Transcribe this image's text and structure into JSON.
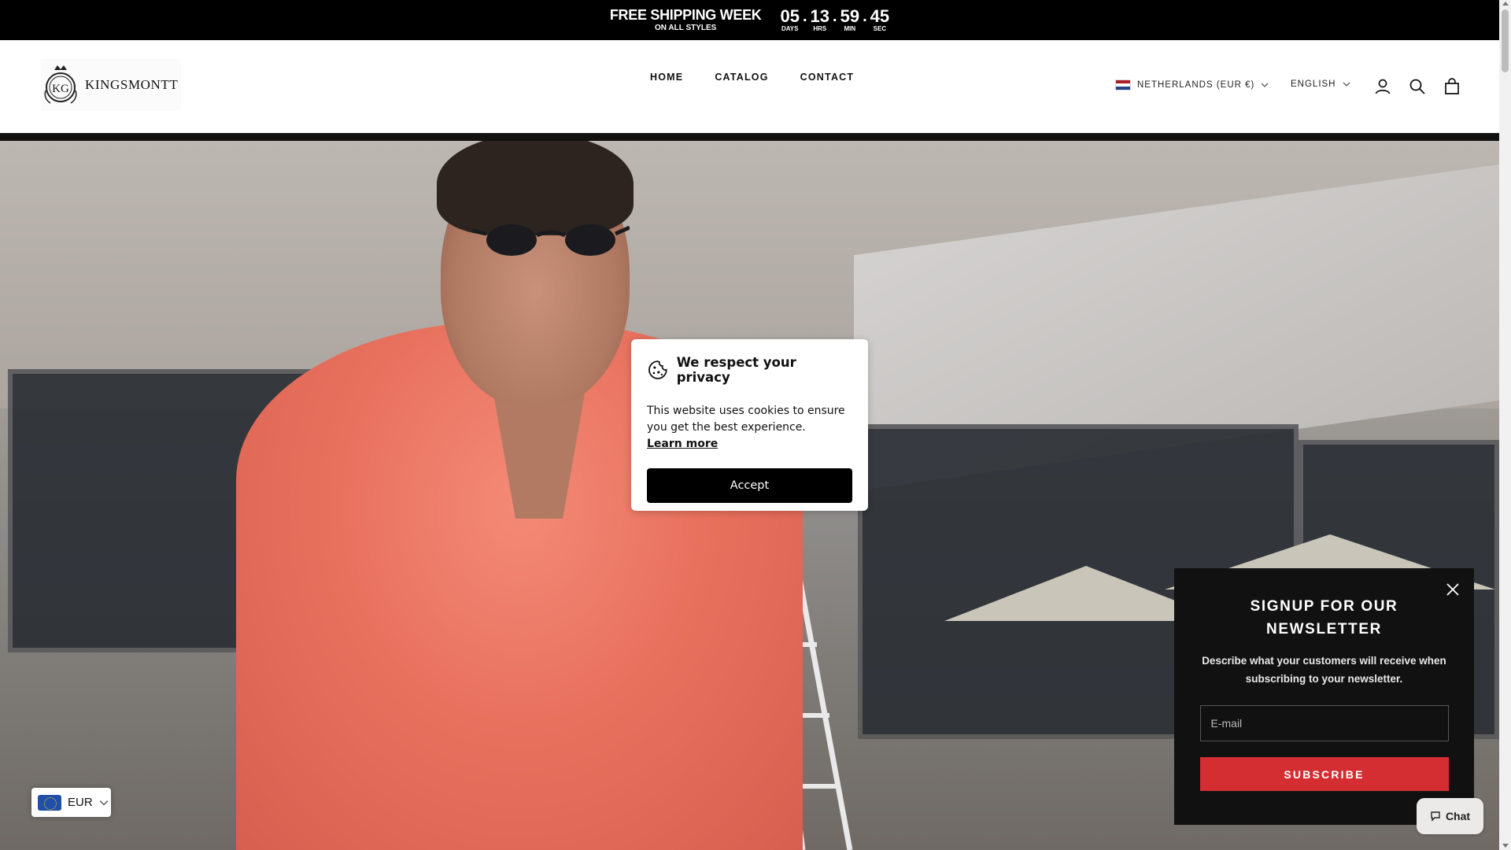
{
  "announcement": {
    "promo_title": "FREE SHIPPING WEEK",
    "promo_sub": "ON ALL STYLES",
    "timer": [
      {
        "value": "05",
        "label": "DAYS"
      },
      {
        "value": "13",
        "label": "HRS"
      },
      {
        "value": "59",
        "label": "MIN"
      },
      {
        "value": "45",
        "label": "SEC"
      }
    ],
    "separator": "."
  },
  "header": {
    "brand": "KINGSMONTT",
    "nav": [
      "HOME",
      "CATALOG",
      "CONTACT"
    ],
    "country": "NETHERLANDS (EUR €)",
    "language": "ENGLISH",
    "icons": [
      "account-icon",
      "search-icon",
      "cart-icon"
    ]
  },
  "cookie": {
    "title": "We respect your privacy",
    "body": "This website uses cookies to ensure you get the best experience.",
    "link": "Learn more",
    "button": "Accept"
  },
  "newsletter": {
    "title": "SIGNUP FOR OUR NEWSLETTER",
    "description": "Describe what your customers will receive when subscribing to your newsletter.",
    "email_placeholder": "E-mail",
    "button": "SUBSCRIBE"
  },
  "chat": {
    "label": "Chat"
  },
  "currency": {
    "code": "EUR"
  },
  "colors": {
    "accent": "#d42e33",
    "dark": "#111111"
  }
}
